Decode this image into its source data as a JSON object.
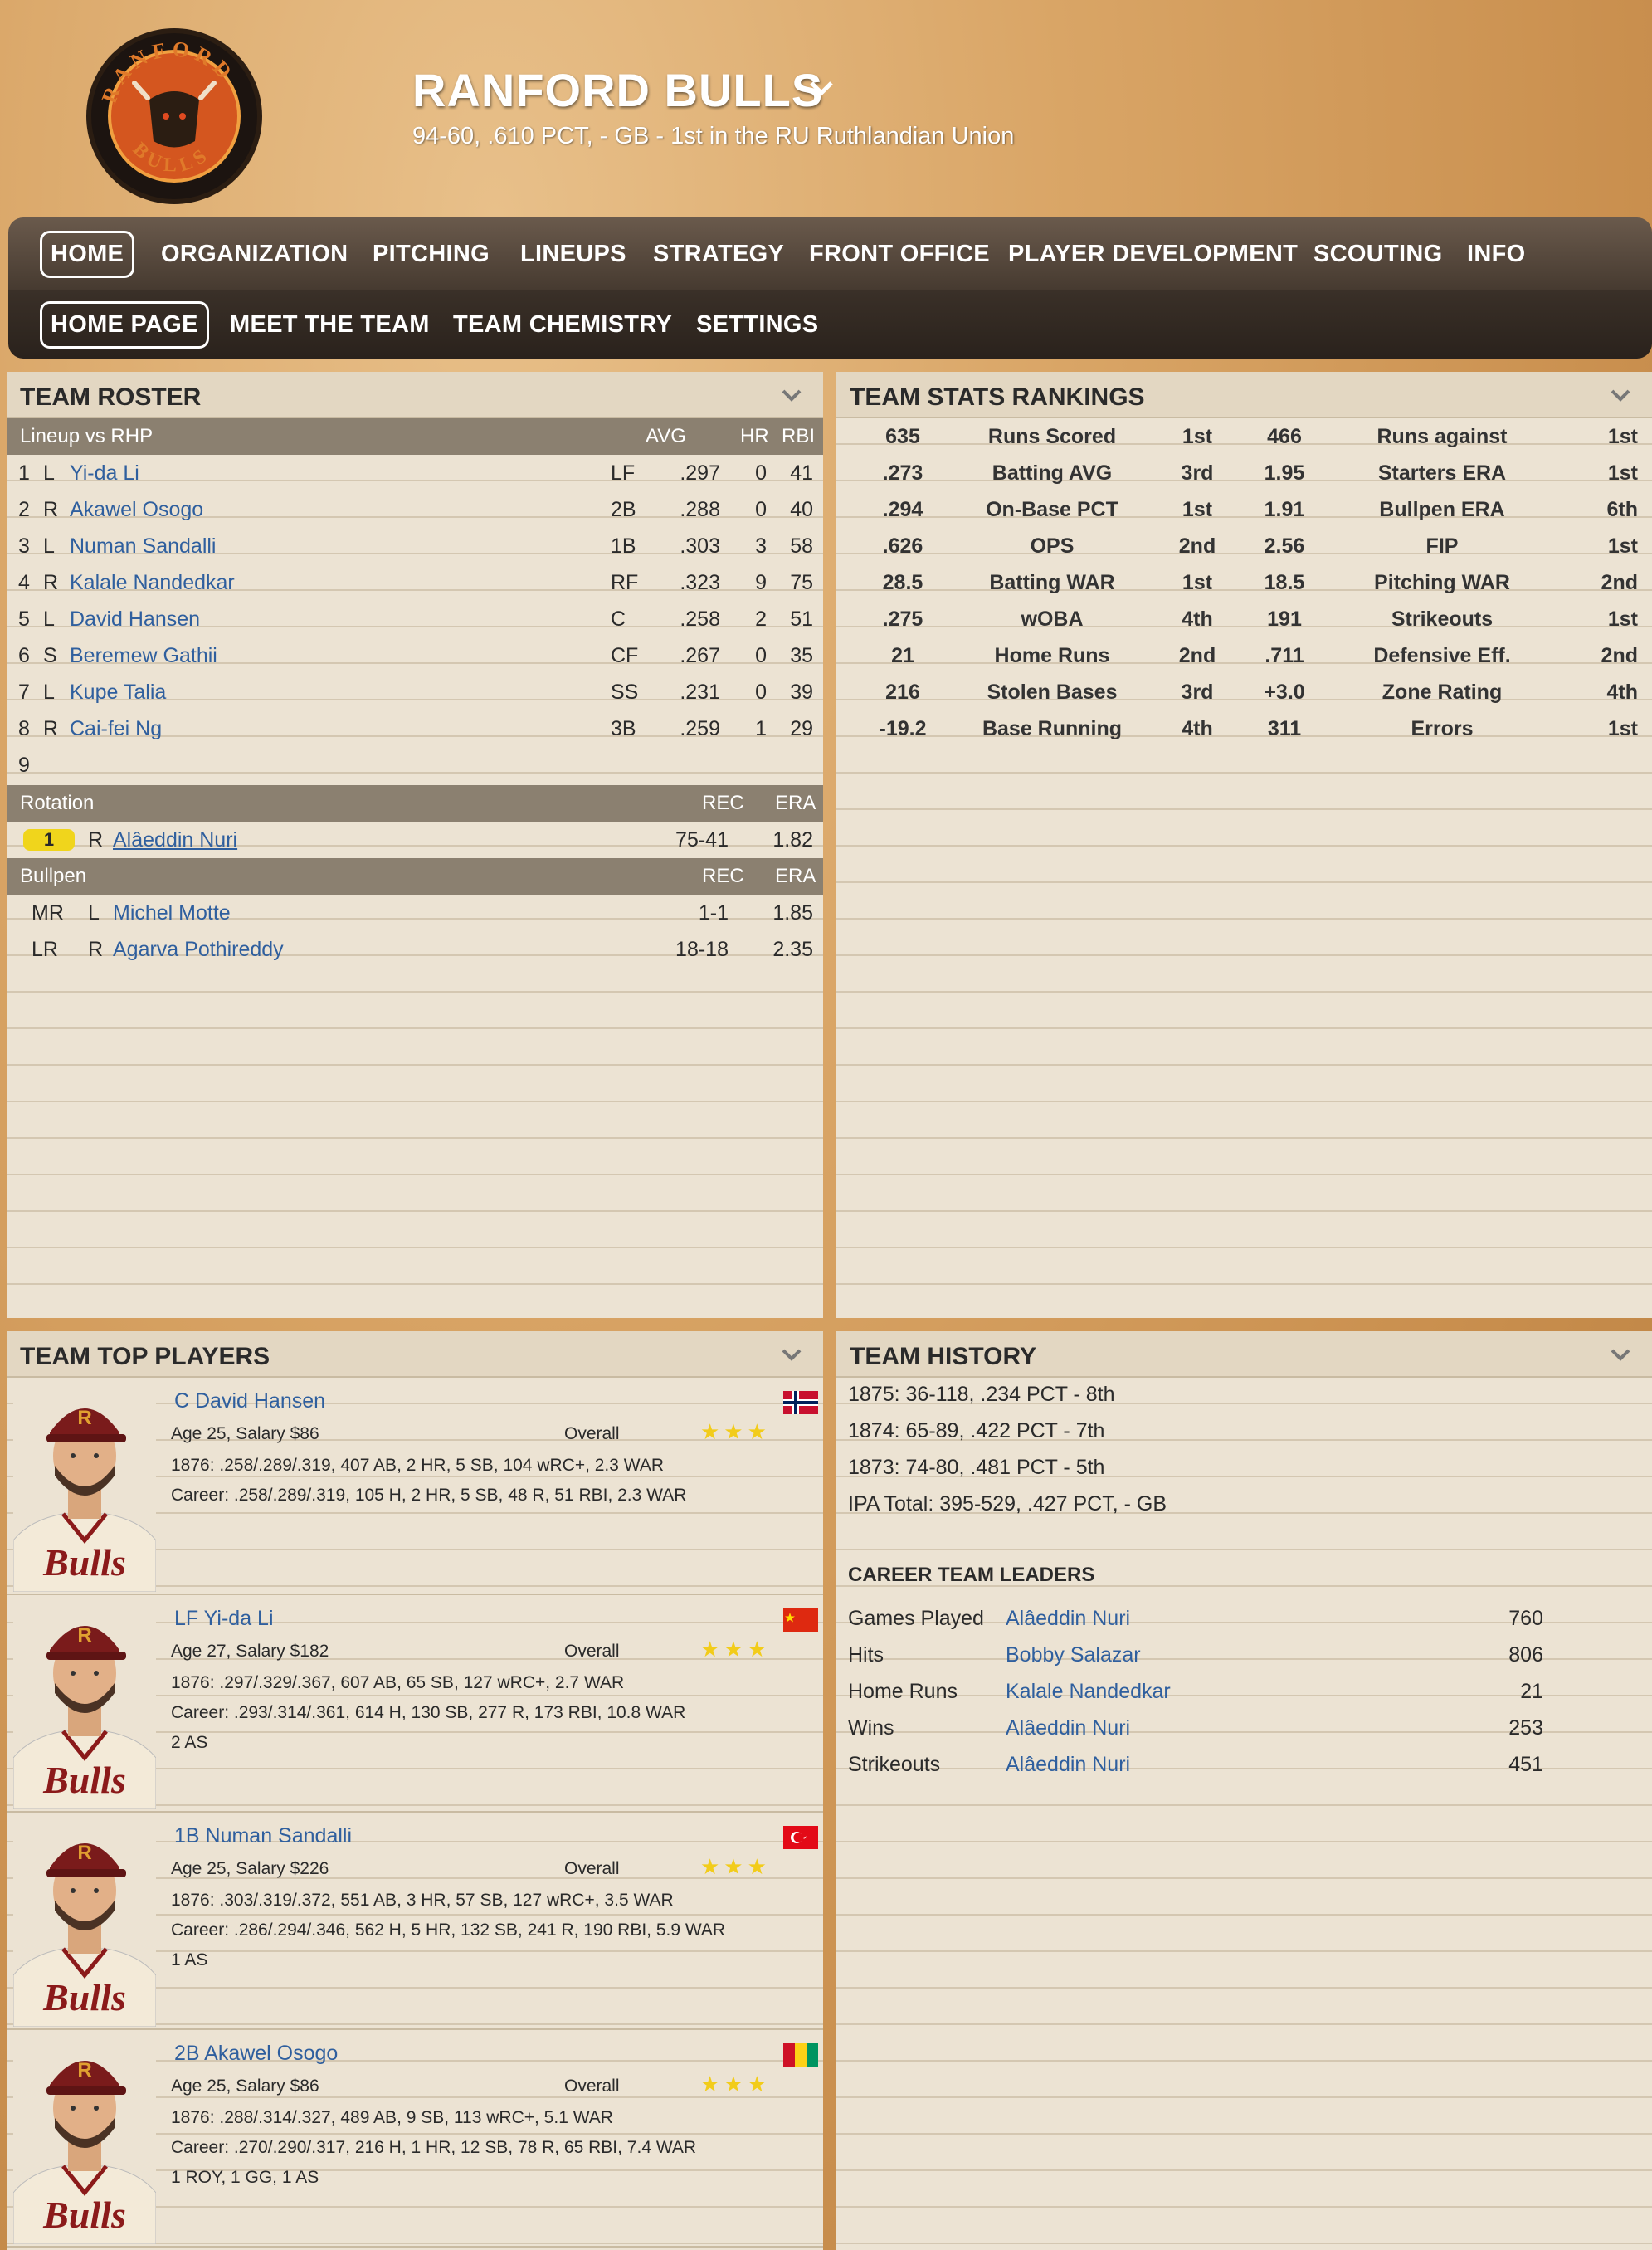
{
  "team": {
    "name": "RANFORD BULLS",
    "subtitle": "94-60, .610 PCT, - GB - 1st in the RU Ruthlandian Union",
    "logo_text_top": "RANFORD",
    "logo_text_bottom": "BULLS"
  },
  "nav": {
    "main": [
      "HOME",
      "ORGANIZATION",
      "PITCHING",
      "LINEUPS",
      "STRATEGY",
      "FRONT OFFICE",
      "PLAYER DEVELOPMENT",
      "SCOUTING",
      "INFO"
    ],
    "sub": [
      "HOME PAGE",
      "MEET THE TEAM",
      "TEAM CHEMISTRY",
      "SETTINGS"
    ]
  },
  "roster": {
    "title": "TEAM ROSTER",
    "lineup_header": {
      "label": "Lineup vs RHP",
      "avg": "AVG",
      "hr": "HR",
      "rbi": "RBI"
    },
    "lineup": [
      {
        "n": "1",
        "hand": "L",
        "name": "Yi-da Li",
        "pos": "LF",
        "avg": ".297",
        "hr": "0",
        "rbi": "41"
      },
      {
        "n": "2",
        "hand": "R",
        "name": "Akawel Osogo",
        "pos": "2B",
        "avg": ".288",
        "hr": "0",
        "rbi": "40"
      },
      {
        "n": "3",
        "hand": "L",
        "name": "Numan Sandalli",
        "pos": "1B",
        "avg": ".303",
        "hr": "3",
        "rbi": "58"
      },
      {
        "n": "4",
        "hand": "R",
        "name": "Kalale Nandedkar",
        "pos": "RF",
        "avg": ".323",
        "hr": "9",
        "rbi": "75"
      },
      {
        "n": "5",
        "hand": "L",
        "name": "David Hansen",
        "pos": "C",
        "avg": ".258",
        "hr": "2",
        "rbi": "51"
      },
      {
        "n": "6",
        "hand": "S",
        "name": "Beremew Gathii",
        "pos": "CF",
        "avg": ".267",
        "hr": "0",
        "rbi": "35"
      },
      {
        "n": "7",
        "hand": "L",
        "name": "Kupe Talia",
        "pos": "SS",
        "avg": ".231",
        "hr": "0",
        "rbi": "39"
      },
      {
        "n": "8",
        "hand": "R",
        "name": "Cai-fei Ng",
        "pos": "3B",
        "avg": ".259",
        "hr": "1",
        "rbi": "29"
      },
      {
        "n": "9",
        "hand": "",
        "name": "",
        "pos": "",
        "avg": "",
        "hr": "",
        "rbi": ""
      }
    ],
    "rotation_header": {
      "label": "Rotation",
      "rec": "REC",
      "era": "ERA"
    },
    "rotation": [
      {
        "slot": "1",
        "hand": "R",
        "name": "Alâeddin Nuri",
        "rec": "75-41",
        "era": "1.82"
      }
    ],
    "bullpen_header": {
      "label": "Bullpen",
      "rec": "REC",
      "era": "ERA"
    },
    "bullpen": [
      {
        "role": "MR",
        "hand": "L",
        "name": "Michel Motte",
        "rec": "1-1",
        "era": "1.85"
      },
      {
        "role": "LR",
        "hand": "R",
        "name": "Agarva Pothireddy",
        "rec": "18-18",
        "era": "2.35"
      }
    ]
  },
  "rankings": {
    "title": "TEAM STATS RANKINGS",
    "rows": [
      {
        "v1": "635",
        "l1": "Runs Scored",
        "r1": "1st",
        "v2": "466",
        "l2": "Runs against",
        "r2": "1st"
      },
      {
        "v1": ".273",
        "l1": "Batting AVG",
        "r1": "3rd",
        "v2": "1.95",
        "l2": "Starters ERA",
        "r2": "1st"
      },
      {
        "v1": ".294",
        "l1": "On-Base PCT",
        "r1": "1st",
        "v2": "1.91",
        "l2": "Bullpen ERA",
        "r2": "6th"
      },
      {
        "v1": ".626",
        "l1": "OPS",
        "r1": "2nd",
        "v2": "2.56",
        "l2": "FIP",
        "r2": "1st"
      },
      {
        "v1": "28.5",
        "l1": "Batting WAR",
        "r1": "1st",
        "v2": "18.5",
        "l2": "Pitching WAR",
        "r2": "2nd"
      },
      {
        "v1": ".275",
        "l1": "wOBA",
        "r1": "4th",
        "v2": "191",
        "l2": "Strikeouts",
        "r2": "1st"
      },
      {
        "v1": "21",
        "l1": "Home Runs",
        "r1": "2nd",
        "v2": ".711",
        "l2": "Defensive Eff.",
        "r2": "2nd"
      },
      {
        "v1": "216",
        "l1": "Stolen Bases",
        "r1": "3rd",
        "v2": "+3.0",
        "l2": "Zone Rating",
        "r2": "4th"
      },
      {
        "v1": "-19.2",
        "l1": "Base Running",
        "r1": "4th",
        "v2": "311",
        "l2": "Errors",
        "r2": "1st"
      }
    ]
  },
  "top_players": {
    "title": "TEAM TOP PLAYERS",
    "overall_label": "Overall",
    "players": [
      {
        "name": "C David Hansen",
        "info": "Age 25, Salary $86",
        "season": "1876: .258/.289/.319, 407 AB, 2 HR, 5 SB, 104 wRC+, 2.3 WAR",
        "career": "Career: .258/.289/.319, 105 H, 2 HR, 5 SB, 48 R, 51 RBI, 2.3 WAR",
        "awards": "",
        "stars": "★★★",
        "flag": "norway"
      },
      {
        "name": "LF Yi-da Li",
        "info": "Age 27, Salary $182",
        "season": "1876: .297/.329/.367, 607 AB, 65 SB, 127 wRC+, 2.7 WAR",
        "career": "Career: .293/.314/.361, 614 H, 130 SB, 277 R, 173 RBI, 10.8 WAR",
        "awards": "2 AS",
        "stars": "★★★",
        "flag": "china"
      },
      {
        "name": "1B Numan Sandalli",
        "info": "Age 25, Salary $226",
        "season": "1876: .303/.319/.372, 551 AB, 3 HR, 57 SB, 127 wRC+, 3.5 WAR",
        "career": "Career: .286/.294/.346, 562 H, 5 HR, 132 SB, 241 R, 190 RBI, 5.9 WAR",
        "awards": "1 AS",
        "stars": "★★★",
        "flag": "turkey"
      },
      {
        "name": "2B Akawel Osogo",
        "info": "Age 25, Salary $86",
        "season": "1876: .288/.314/.327, 489 AB, 9 SB, 113 wRC+, 5.1 WAR",
        "career": "Career: .270/.290/.317, 216 H, 1 HR, 12 SB, 78 R, 65 RBI, 7.4 WAR",
        "awards": "1 ROY, 1 GG, 1 AS",
        "stars": "★★★",
        "flag": "guinea"
      }
    ]
  },
  "history": {
    "title": "TEAM HISTORY",
    "seasons": [
      "1875: 36-118, .234 PCT - 8th",
      "1874: 65-89, .422 PCT - 7th",
      "1873: 74-80, .481 PCT - 5th",
      "IPA Total: 395-529, .427 PCT, - GB"
    ],
    "leaders_title": "CAREER TEAM LEADERS",
    "leaders": [
      {
        "cat": "Games Played",
        "name": "Alâeddin Nuri",
        "val": "760"
      },
      {
        "cat": "Hits",
        "name": "Bobby Salazar",
        "val": "806"
      },
      {
        "cat": "Home Runs",
        "name": "Kalale Nandedkar",
        "val": "21"
      },
      {
        "cat": "Wins",
        "name": "Alâeddin Nuri",
        "val": "253"
      },
      {
        "cat": "Strikeouts",
        "name": "Alâeddin Nuri",
        "val": "451"
      }
    ]
  }
}
